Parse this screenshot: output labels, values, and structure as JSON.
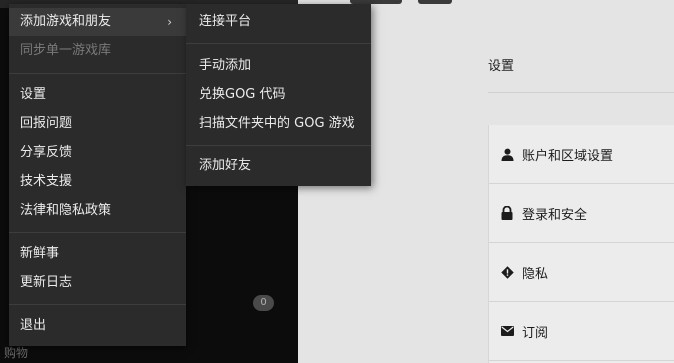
{
  "menu": {
    "items": [
      {
        "label": "添加游戏和朋友"
      },
      {
        "label": "同步单一游戏库"
      },
      {
        "label": "设置"
      },
      {
        "label": "回报问题"
      },
      {
        "label": "分享反馈"
      },
      {
        "label": "技术支援"
      },
      {
        "label": "法律和隐私政策"
      },
      {
        "label": "新鲜事"
      },
      {
        "label": "更新日志"
      },
      {
        "label": "退出"
      }
    ],
    "chevron": "›"
  },
  "submenu": {
    "items": [
      {
        "label": "连接平台"
      },
      {
        "label": "手动添加"
      },
      {
        "label": "兑换GOG 代码"
      },
      {
        "label": "扫描文件夹中的 GOG 游戏"
      },
      {
        "label": "添加好友"
      }
    ]
  },
  "sidebar": {
    "count_badge": "0",
    "shop_label": "购物"
  },
  "settings": {
    "title": "设置",
    "items": [
      {
        "label": "账户和区域设置",
        "icon": "user-icon"
      },
      {
        "label": "登录和安全",
        "icon": "lock-icon"
      },
      {
        "label": "隐私",
        "icon": "privacy-diamond-icon"
      },
      {
        "label": "订阅",
        "icon": "envelope-icon"
      }
    ]
  },
  "colors": {
    "menu_bg": "#2b2b2b",
    "sidebar_bg": "#0c0c0c",
    "content_bg": "#e4e4e4"
  }
}
